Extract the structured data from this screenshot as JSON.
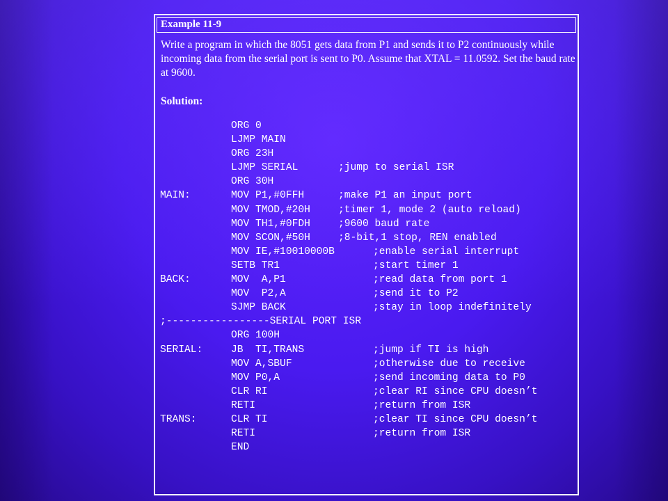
{
  "example": {
    "title": "Example 11-9",
    "prompt": "Write a program in which the 8051 gets data from P1 and sends it to P2 continuously while incoming data from the serial port is sent to P0. Assume that XTAL = 11.0592. Set the baud rate at 9600.",
    "solution_label": "Solution:"
  },
  "code": [
    {
      "label": "",
      "instr": "ORG 0",
      "comment": ""
    },
    {
      "label": "",
      "instr": "LJMP MAIN",
      "comment": ""
    },
    {
      "label": "",
      "instr": "ORG 23H",
      "comment": ""
    },
    {
      "label": "",
      "instr": "LJMP SERIAL",
      "comment": ";jump to serial ISR"
    },
    {
      "label": "",
      "instr": "ORG 30H",
      "comment": ""
    },
    {
      "label": "MAIN:",
      "instr": "MOV P1,#0FFH",
      "comment": ";make P1 an input port"
    },
    {
      "label": "",
      "instr": "MOV TMOD,#20H",
      "comment": ";timer 1, mode 2 (auto reload)"
    },
    {
      "label": "",
      "instr": "MOV TH1,#0FDH",
      "comment": ";9600 baud rate"
    },
    {
      "label": "",
      "instr": "MOV SCON,#50H",
      "comment": ";8-bit,1 stop, REN enabled"
    },
    {
      "label": "",
      "instr": "MOV IE,#10010000B",
      "comment": ";enable serial interrupt",
      "wide": true
    },
    {
      "label": "",
      "instr": "SETB TR1",
      "comment": ";start timer 1",
      "wide": true
    },
    {
      "label": "BACK:",
      "instr": "MOV  A,P1",
      "comment": ";read data from port 1",
      "wide": true
    },
    {
      "label": "",
      "instr": "MOV  P2,A",
      "comment": ";send it to P2",
      "wide": true
    },
    {
      "label": "",
      "instr": "SJMP BACK",
      "comment": ";stay in loop indefinitely",
      "wide": true
    },
    {
      "full": ";-----------------SERIAL PORT ISR"
    },
    {
      "label": "",
      "instr": "ORG 100H",
      "comment": ""
    },
    {
      "label": "SERIAL:",
      "instr": "JB  TI,TRANS",
      "comment": ";jump if TI is high",
      "wide": true
    },
    {
      "label": "",
      "instr": "MOV A,SBUF",
      "comment": ";otherwise due to receive",
      "wide": true
    },
    {
      "label": "",
      "instr": "MOV P0,A",
      "comment": ";send incoming data to P0",
      "wide": true
    },
    {
      "label": "",
      "instr": "CLR RI",
      "comment": ";clear RI since CPU doesn’t",
      "wide": true
    },
    {
      "label": "",
      "instr": "RETI",
      "comment": ";return from ISR",
      "wide": true
    },
    {
      "label": "TRANS:",
      "instr": "CLR TI",
      "comment": ";clear TI since CPU doesn’t",
      "wide": true
    },
    {
      "label": "",
      "instr": "RETI",
      "comment": ";return from ISR",
      "wide": true
    },
    {
      "label": "",
      "instr": "END",
      "comment": ""
    }
  ]
}
